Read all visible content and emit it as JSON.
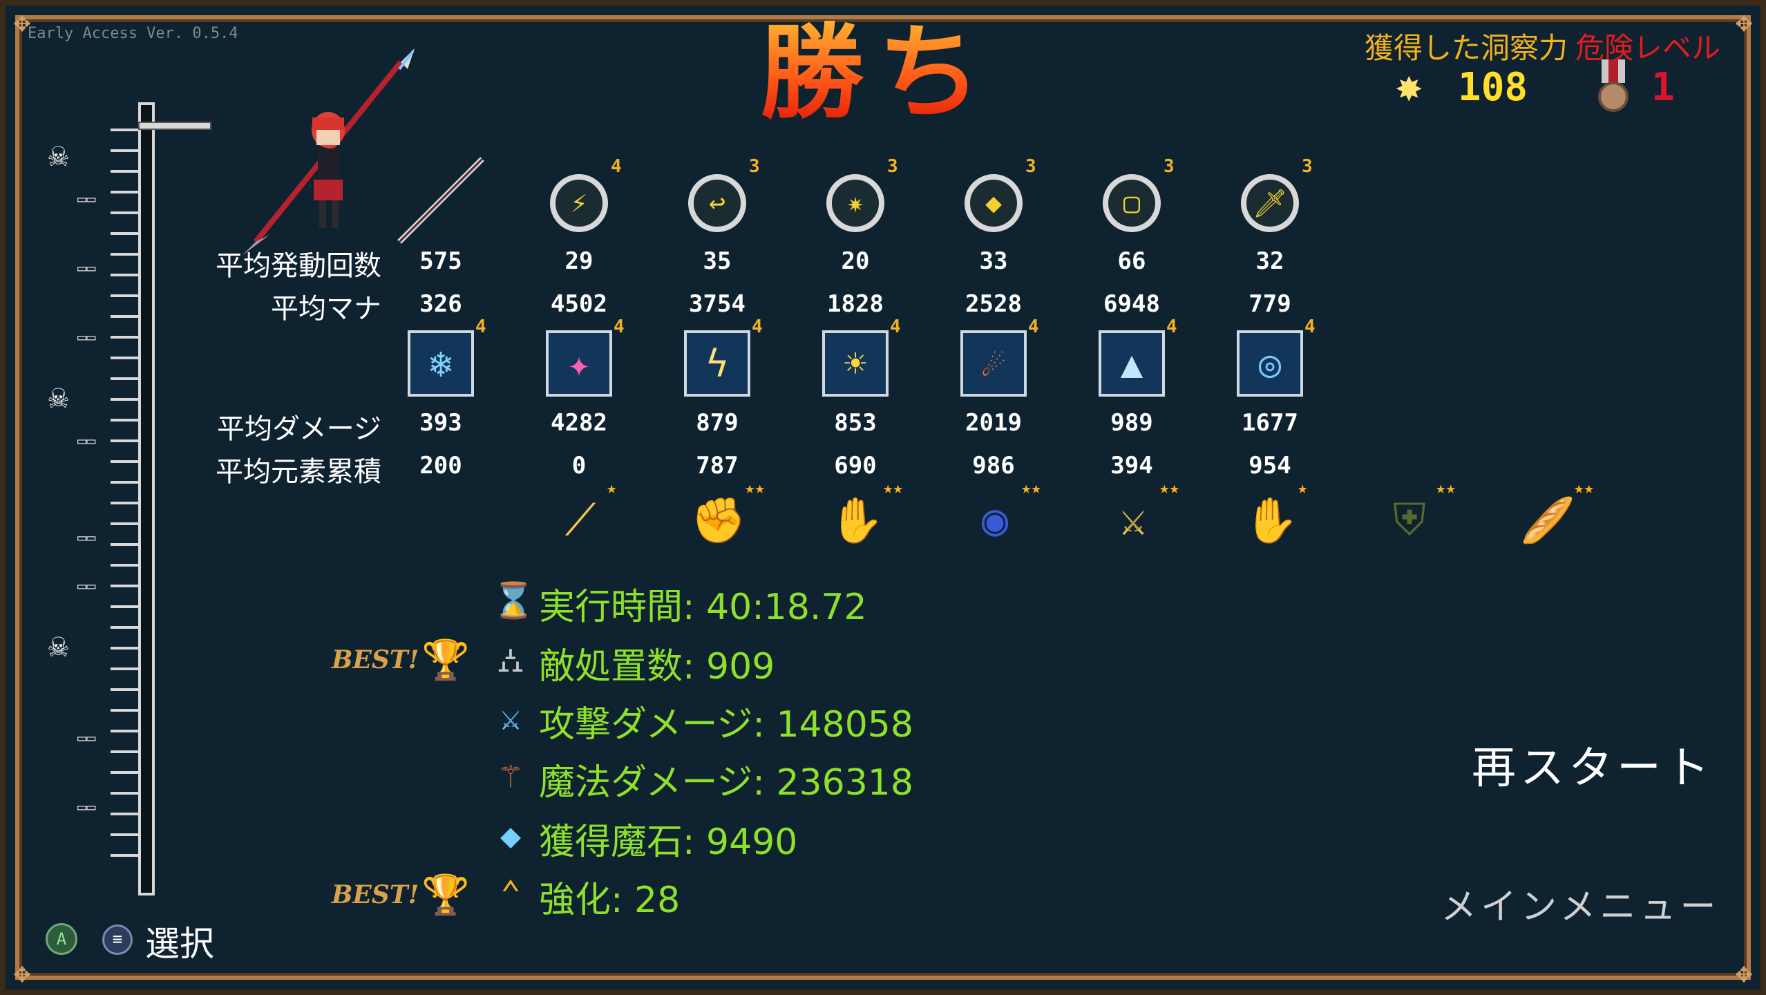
{
  "version": "Early Access Ver. 0.5.4",
  "title": "勝ち",
  "header": {
    "insight_label": "獲得した洞察力",
    "insight_value": "108",
    "danger_label": "危険レベル",
    "danger_value": "1"
  },
  "weapons": {
    "row_label_activations": "平均発動回数",
    "row_label_mana": "平均マナ",
    "items": [
      {
        "icon": "spear-icon",
        "level": "",
        "activations": "575",
        "mana": "326"
      },
      {
        "icon": "lightning-ring-icon",
        "level": "4",
        "activations": "29",
        "mana": "4502"
      },
      {
        "icon": "return-ring-icon",
        "level": "3",
        "activations": "35",
        "mana": "3754"
      },
      {
        "icon": "spider-ring-icon",
        "level": "3",
        "activations": "20",
        "mana": "1828"
      },
      {
        "icon": "crosshair-gem-icon",
        "level": "3",
        "activations": "33",
        "mana": "2528"
      },
      {
        "icon": "square-ring-icon",
        "level": "3",
        "activations": "66",
        "mana": "6948"
      },
      {
        "icon": "sword-crosshair-icon",
        "level": "3",
        "activations": "32",
        "mana": "779"
      }
    ]
  },
  "skills": {
    "row_label_damage": "平均ダメージ",
    "row_label_element": "平均元素累積",
    "items": [
      {
        "icon": "ice-figure-icon",
        "level": "4",
        "damage": "393",
        "element": "200"
      },
      {
        "icon": "crystal-burst-icon",
        "level": "4",
        "damage": "4282",
        "element": "0"
      },
      {
        "icon": "lightning-veins-icon",
        "level": "4",
        "damage": "879",
        "element": "787"
      },
      {
        "icon": "sun-burst-icon",
        "level": "4",
        "damage": "853",
        "element": "690"
      },
      {
        "icon": "fire-meteor-icon",
        "level": "4",
        "damage": "2019",
        "element": "986"
      },
      {
        "icon": "ice-spikes-icon",
        "level": "4",
        "damage": "989",
        "element": "394"
      },
      {
        "icon": "blue-seal-icon",
        "level": "4",
        "damage": "1677",
        "element": "954"
      }
    ]
  },
  "items_row": [
    {
      "icon": "golden-lance-icon",
      "stars": "★"
    },
    {
      "icon": "gauntlet-icon",
      "stars": "★★"
    },
    {
      "icon": "fire-hand-icon",
      "stars": "★★"
    },
    {
      "icon": "blue-orb-hand-icon",
      "stars": "★★"
    },
    {
      "icon": "golden-blade-icon",
      "stars": "★★"
    },
    {
      "icon": "pale-hand-icon",
      "stars": "★"
    },
    {
      "icon": "green-armor-icon",
      "stars": "★★"
    },
    {
      "icon": "bread-icon",
      "stars": "★★"
    }
  ],
  "summary": {
    "time": "実行時間: 40:18.72",
    "kills": "敵処置数: 909",
    "attack_damage": "攻撃ダメージ: 148058",
    "magic_damage": "魔法ダメージ: 236318",
    "magic_stones": "獲得魔石: 9490",
    "upgrades": "強化: 28",
    "best_label": "BEST!"
  },
  "menu": {
    "restart": "再スタート",
    "main_menu": "メインメニュー",
    "select": "選択",
    "a_button": "A"
  }
}
